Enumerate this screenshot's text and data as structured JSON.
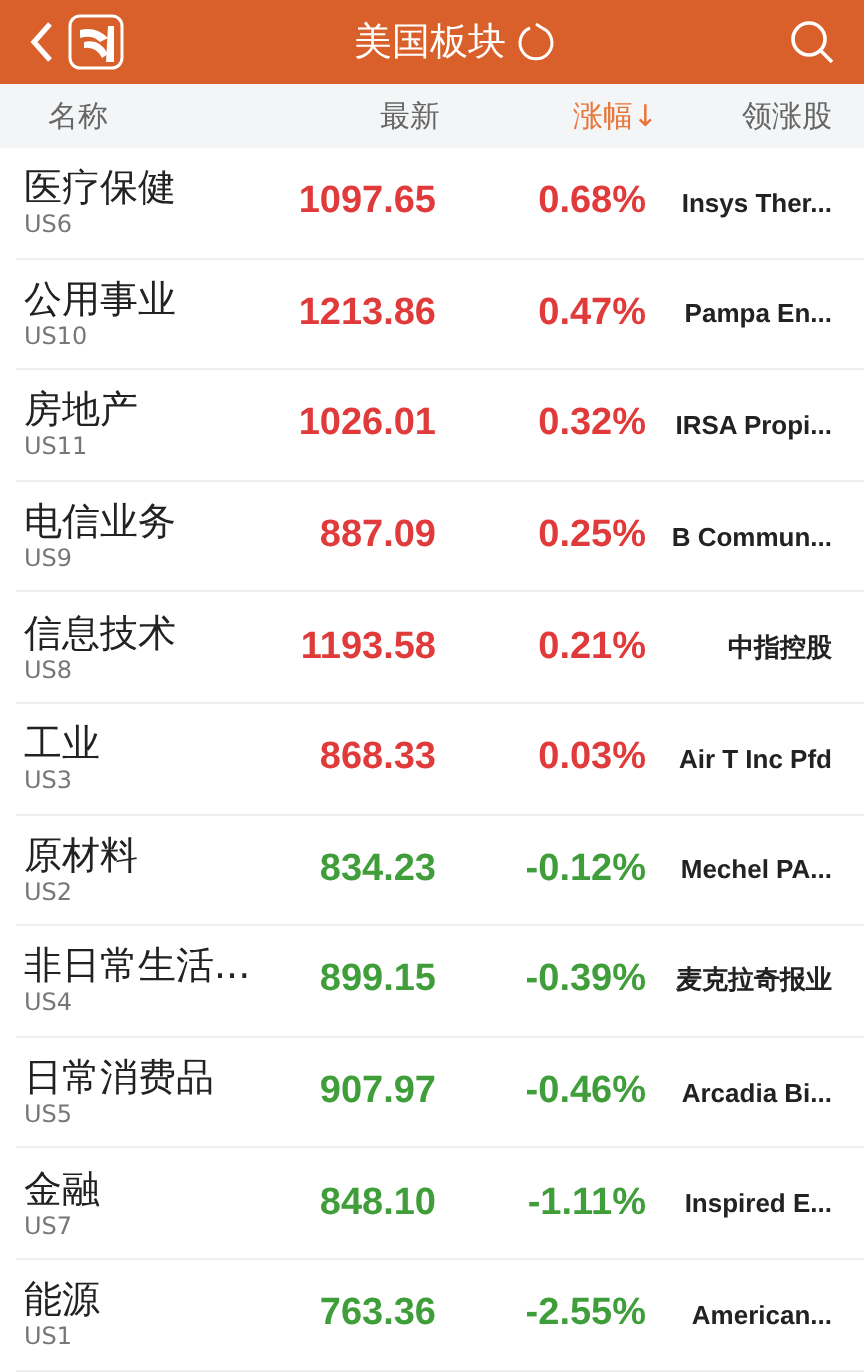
{
  "header": {
    "title": "美国板块"
  },
  "columns": [
    {
      "label": "名称",
      "selected": false
    },
    {
      "label": "最新",
      "selected": false
    },
    {
      "label": "涨幅",
      "selected": true,
      "sort_arrow": "↓"
    },
    {
      "label": "领涨股",
      "selected": false
    }
  ],
  "rows": [
    {
      "name": "医疗保健",
      "code": "US6",
      "price": "1097.65",
      "change": "0.68%",
      "color": "#e03a3a",
      "leader": "Insys Ther..."
    },
    {
      "name": "公用事业",
      "code": "US10",
      "price": "1213.86",
      "change": "0.47%",
      "color": "#e03a3a",
      "leader": "Pampa En..."
    },
    {
      "name": "房地产",
      "code": "US11",
      "price": "1026.01",
      "change": "0.32%",
      "color": "#e03a3a",
      "leader": "IRSA Propi..."
    },
    {
      "name": "电信业务",
      "code": "US9",
      "price": "887.09",
      "change": "0.25%",
      "color": "#e03a3a",
      "leader": "B Commun..."
    },
    {
      "name": "信息技术",
      "code": "US8",
      "price": "1193.58",
      "change": "0.21%",
      "color": "#e03a3a",
      "leader": "中指控股"
    },
    {
      "name": "工业",
      "code": "US3",
      "price": "868.33",
      "change": "0.03%",
      "color": "#e03a3a",
      "leader": "Air T Inc Pfd"
    },
    {
      "name": "原材料",
      "code": "US2",
      "price": "834.23",
      "change": "-0.12%",
      "color": "#3f9e3a",
      "leader": "Mechel PA..."
    },
    {
      "name": "非日常生活...",
      "code": "US4",
      "price": "899.15",
      "change": "-0.39%",
      "color": "#3f9e3a",
      "leader": "麦克拉奇报业"
    },
    {
      "name": "日常消费品",
      "code": "US5",
      "price": "907.97",
      "change": "-0.46%",
      "color": "#3f9e3a",
      "leader": "Arcadia Bi..."
    },
    {
      "name": "金融",
      "code": "US7",
      "price": "848.10",
      "change": "-1.11%",
      "color": "#3f9e3a",
      "leader": "Inspired E..."
    },
    {
      "name": "能源",
      "code": "US1",
      "price": "763.36",
      "change": "-2.55%",
      "color": "#3f9e3a",
      "leader": "American..."
    }
  ]
}
